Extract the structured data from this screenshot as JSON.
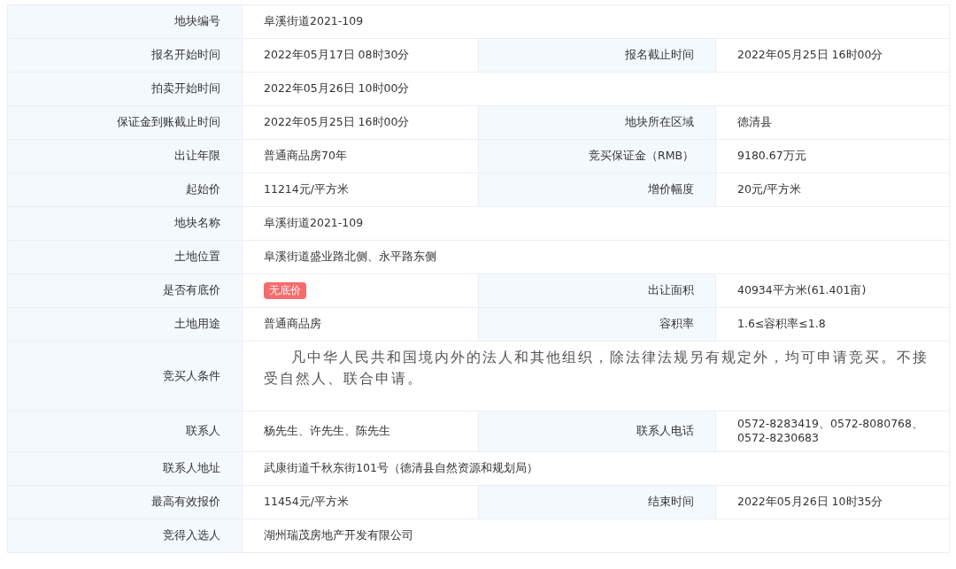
{
  "rows": [
    {
      "fields": [
        {
          "label": "地块编号",
          "value": "阜溪街道2021-109"
        }
      ]
    },
    {
      "fields": [
        {
          "label": "报名开始时间",
          "value": "2022年05月17日 08时30分"
        },
        {
          "label": "报名截止时间",
          "value": "2022年05月25日 16时00分"
        }
      ]
    },
    {
      "fields": [
        {
          "label": "拍卖开始时间",
          "value": "2022年05月26日 10时00分"
        }
      ]
    },
    {
      "fields": [
        {
          "label": "保证金到账截止时间",
          "value": "2022年05月25日 16时00分"
        },
        {
          "label": "地块所在区域",
          "value": "德清县"
        }
      ]
    },
    {
      "fields": [
        {
          "label": "出让年限",
          "value": "普通商品房70年"
        },
        {
          "label": "竞买保证金（RMB）",
          "value": "9180.67万元"
        }
      ]
    },
    {
      "fields": [
        {
          "label": "起始价",
          "value": "11214元/平方米"
        },
        {
          "label": "增价幅度",
          "value": "20元/平方米"
        }
      ]
    },
    {
      "fields": [
        {
          "label": "地块名称",
          "value": "阜溪街道2021-109"
        }
      ]
    },
    {
      "fields": [
        {
          "label": "土地位置",
          "value": "阜溪街道盛业路北侧、永平路东侧"
        }
      ]
    },
    {
      "fields": [
        {
          "label": "是否有底价",
          "value": "无底价",
          "kind": "badge",
          "color": "#f56c6c"
        },
        {
          "label": "出让面积",
          "value": "40934平方米(61.401亩)"
        }
      ]
    },
    {
      "fields": [
        {
          "label": "土地用途",
          "value": "普通商品房"
        },
        {
          "label": "容积率",
          "value": "1.6≤容积率≤1.8"
        }
      ]
    },
    {
      "fields": [
        {
          "label": "竞买人条件",
          "value": "凡中华人民共和国境内外的法人和其他组织，除法律法规另有规定外，均可申请竞买。不接受自然人、联合申请。",
          "kind": "paragraph"
        }
      ]
    },
    {
      "fields": [
        {
          "label": "联系人",
          "value": "杨先生、许先生、陈先生"
        },
        {
          "label": "联系人电话",
          "value": "0572-8283419、0572-8080768、0572-8230683"
        }
      ]
    },
    {
      "fields": [
        {
          "label": "联系人地址",
          "value": "武康街道千秋东街101号（德清县自然资源和规划局）"
        }
      ]
    },
    {
      "fields": [
        {
          "label": "最高有效报价",
          "value": "11454元/平方米"
        },
        {
          "label": "结束时间",
          "value": "2022年05月26日 10时35分"
        }
      ]
    },
    {
      "fields": [
        {
          "label": "竞得入选人",
          "value": "湖州瑞茂房地产开发有限公司"
        }
      ]
    }
  ]
}
